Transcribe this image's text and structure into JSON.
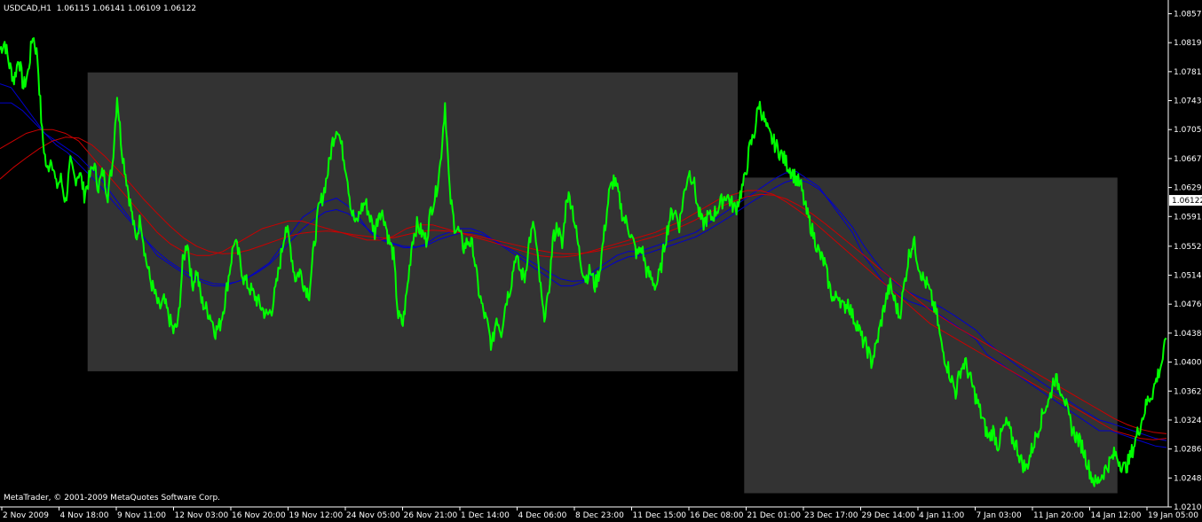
{
  "header": {
    "symbol": "USDCAD,H1",
    "ohlc": "1.06115 1.06141 1.06109 1.06122"
  },
  "footer": {
    "copyright": "MetaTrader, © 2001-2009 MetaQuotes Software Corp."
  },
  "colors": {
    "background": "#000000",
    "price_line": "#00ff00",
    "ma_blue": "#0000cc",
    "ma_red": "#cc0000",
    "box_fill": "#333333",
    "axis": "#ffffff"
  },
  "chart_data": {
    "type": "line",
    "symbol": "USDCAD",
    "timeframe": "H1",
    "current_price": 1.06122,
    "current_price_label": "1.06122",
    "ylim": [
      1.021,
      1.0875
    ],
    "y_ticks": [
      {
        "v": 1.0857,
        "l": "1.08570"
      },
      {
        "v": 1.0819,
        "l": "1.08190"
      },
      {
        "v": 1.0781,
        "l": "1.07810"
      },
      {
        "v": 1.0743,
        "l": "1.07430"
      },
      {
        "v": 1.0705,
        "l": "1.07050"
      },
      {
        "v": 1.0667,
        "l": "1.06670"
      },
      {
        "v": 1.0629,
        "l": "1.06290"
      },
      {
        "v": 1.0591,
        "l": "1.05910"
      },
      {
        "v": 1.0552,
        "l": "1.05520"
      },
      {
        "v": 1.0514,
        "l": "1.05140"
      },
      {
        "v": 1.0476,
        "l": "1.04760"
      },
      {
        "v": 1.0438,
        "l": "1.04380"
      },
      {
        "v": 1.04,
        "l": "1.04000"
      },
      {
        "v": 1.0362,
        "l": "1.03620"
      },
      {
        "v": 1.0324,
        "l": "1.03240"
      },
      {
        "v": 1.0286,
        "l": "1.02860"
      },
      {
        "v": 1.0248,
        "l": "1.02480"
      },
      {
        "v": 1.021,
        "l": "1.02100"
      }
    ],
    "x_ticks": [
      "2 Nov 2009",
      "4 Nov 18:00",
      "9 Nov 11:00",
      "12 Nov 03:00",
      "16 Nov 20:00",
      "19 Nov 12:00",
      "24 Nov 05:00",
      "26 Nov 21:00",
      "1 Dec 14:00",
      "4 Dec 06:00",
      "8 Dec 23:00",
      "11 Dec 15:00",
      "16 Dec 08:00",
      "21 Dec 01:00",
      "23 Dec 17:00",
      "29 Dec 14:00",
      "4 Jan 11:00",
      "7 Jan 03:00",
      "11 Jan 20:00",
      "14 Jan 12:00",
      "19 Jan 05:00"
    ],
    "series": [
      {
        "role": "price",
        "values": [
          1.081,
          1.082,
          1.079,
          1.077,
          1.08,
          1.076,
          1.078,
          1.083,
          1.08,
          1.07,
          1.065,
          1.067,
          1.063,
          1.064,
          1.061,
          1.066,
          1.064,
          1.065,
          1.062,
          1.064,
          1.066,
          1.063,
          1.065,
          1.062,
          1.066,
          1.075,
          1.068,
          1.064,
          1.06,
          1.056,
          1.059,
          1.054,
          1.051,
          1.049,
          1.047,
          1.048,
          1.046,
          1.044,
          1.045,
          1.053,
          1.056,
          1.05,
          1.052,
          1.048,
          1.047,
          1.046,
          1.044,
          1.045,
          1.048,
          1.052,
          1.056,
          1.054,
          1.051,
          1.05,
          1.049,
          1.048,
          1.047,
          1.046,
          1.047,
          1.05,
          1.054,
          1.058,
          1.055,
          1.051,
          1.052,
          1.05,
          1.049,
          1.055,
          1.06,
          1.062,
          1.065,
          1.069,
          1.071,
          1.068,
          1.065,
          1.06,
          1.058,
          1.06,
          1.061,
          1.059,
          1.057,
          1.06,
          1.059,
          1.056,
          1.054,
          1.046,
          1.045,
          1.05,
          1.056,
          1.058,
          1.057,
          1.056,
          1.06,
          1.062,
          1.066,
          1.074,
          1.062,
          1.058,
          1.057,
          1.055,
          1.056,
          1.055,
          1.05,
          1.047,
          1.045,
          1.042,
          1.046,
          1.044,
          1.048,
          1.05,
          1.054,
          1.052,
          1.051,
          1.056,
          1.058,
          1.052,
          1.046,
          1.048,
          1.056,
          1.058,
          1.055,
          1.062,
          1.061,
          1.057,
          1.053,
          1.051,
          1.052,
          1.05,
          1.052,
          1.057,
          1.062,
          1.064,
          1.062,
          1.059,
          1.058,
          1.056,
          1.054,
          1.055,
          1.052,
          1.051,
          1.05,
          1.052,
          1.056,
          1.059,
          1.06,
          1.058,
          1.062,
          1.065,
          1.064,
          1.06,
          1.058,
          1.059,
          1.059,
          1.06,
          1.061,
          1.062,
          1.061,
          1.06,
          1.062,
          1.064,
          1.068,
          1.07,
          1.074,
          1.072,
          1.07,
          1.069,
          1.068,
          1.067,
          1.066,
          1.065,
          1.064,
          1.063,
          1.06,
          1.058,
          1.056,
          1.054,
          1.053,
          1.05,
          1.048,
          1.049,
          1.047,
          1.048,
          1.046,
          1.045,
          1.043,
          1.042,
          1.04,
          1.042,
          1.045,
          1.048,
          1.05,
          1.048,
          1.046,
          1.05,
          1.054,
          1.056,
          1.053,
          1.051,
          1.05,
          1.048,
          1.046,
          1.042,
          1.04,
          1.038,
          1.036,
          1.039,
          1.04,
          1.038,
          1.036,
          1.034,
          1.032,
          1.03,
          1.031,
          1.029,
          1.031,
          1.032,
          1.03,
          1.029,
          1.027,
          1.026,
          1.028,
          1.03,
          1.032,
          1.034,
          1.035,
          1.038,
          1.037,
          1.036,
          1.033,
          1.031,
          1.03,
          1.029,
          1.027,
          1.025,
          1.024,
          1.025,
          1.026,
          1.027,
          1.028,
          1.027,
          1.026,
          1.027,
          1.029,
          1.031,
          1.033,
          1.035,
          1.036,
          1.038,
          1.04,
          1.043
        ]
      },
      {
        "role": "ma-blue-fast",
        "values": [
          1.0765,
          1.076,
          1.074,
          1.072,
          1.07,
          1.069,
          1.068,
          1.067,
          1.0655,
          1.064,
          1.062,
          1.06,
          1.058,
          1.056,
          1.054,
          1.053,
          1.052,
          1.051,
          1.0505,
          1.05,
          1.05,
          1.0505,
          1.051,
          1.052,
          1.053,
          1.055,
          1.057,
          1.059,
          1.06,
          1.061,
          1.0615,
          1.0605,
          1.059,
          1.057,
          1.056,
          1.0555,
          1.055,
          1.055,
          1.0555,
          1.0565,
          1.057,
          1.0575,
          1.0575,
          1.057,
          1.056,
          1.055,
          1.054,
          1.053,
          1.052,
          1.051,
          1.05,
          1.05,
          1.0505,
          1.052,
          1.053,
          1.054,
          1.0545,
          1.0545,
          1.055,
          1.0555,
          1.056,
          1.0565,
          1.057,
          1.058,
          1.059,
          1.06,
          1.061,
          1.062,
          1.063,
          1.064,
          1.0648,
          1.065,
          1.064,
          1.063,
          1.061,
          1.059,
          1.057,
          1.054,
          1.052,
          1.05,
          1.049,
          1.048,
          1.0475,
          1.047,
          1.046,
          1.045,
          1.044,
          1.043,
          1.041,
          1.04,
          1.039,
          1.038,
          1.037,
          1.036,
          1.035,
          1.034,
          1.033,
          1.032,
          1.031,
          1.031,
          1.0305,
          1.03,
          1.0295,
          1.029,
          1.0288
        ]
      },
      {
        "role": "ma-blue-slow",
        "values": [
          1.074,
          1.074,
          1.073,
          1.0715,
          1.07,
          1.0685,
          1.0675,
          1.066,
          1.0645,
          1.063,
          1.0612,
          1.0595,
          1.0578,
          1.056,
          1.0545,
          1.0533,
          1.0523,
          1.0515,
          1.0508,
          1.0503,
          1.0502,
          1.0505,
          1.051,
          1.0518,
          1.0528,
          1.0543,
          1.056,
          1.0575,
          1.0587,
          1.0597,
          1.06,
          1.0595,
          1.0585,
          1.0572,
          1.0562,
          1.0556,
          1.0552,
          1.0551,
          1.0553,
          1.056,
          1.0565,
          1.0569,
          1.057,
          1.0567,
          1.056,
          1.0552,
          1.0544,
          1.0535,
          1.0526,
          1.0517,
          1.0509,
          1.0506,
          1.0507,
          1.0515,
          1.0524,
          1.0532,
          1.0538,
          1.054,
          1.0544,
          1.0549,
          1.0554,
          1.0559,
          1.0564,
          1.0572,
          1.0581,
          1.059,
          1.06,
          1.061,
          1.0619,
          1.0628,
          1.0636,
          1.064,
          1.0636,
          1.0627,
          1.0612,
          1.0595,
          1.0577,
          1.0553,
          1.0533,
          1.0515,
          1.0502,
          1.0492,
          1.0485,
          1.0479,
          1.0471,
          1.0462,
          1.0452,
          1.0442,
          1.0426,
          1.0414,
          1.0403,
          1.0392,
          1.0382,
          1.0372,
          1.0362,
          1.0352,
          1.0342,
          1.0333,
          1.0324,
          1.032,
          1.0315,
          1.031,
          1.0305,
          1.03,
          1.0297
        ]
      },
      {
        "role": "ma-red-fast",
        "values": [
          1.068,
          1.069,
          1.07,
          1.0705,
          1.0705,
          1.07,
          1.069,
          1.067,
          1.065,
          1.063,
          1.061,
          1.059,
          1.057,
          1.0555,
          1.0545,
          1.054,
          1.054,
          1.0545,
          1.0555,
          1.0565,
          1.0575,
          1.058,
          1.0585,
          1.0585,
          1.058,
          1.0575,
          1.057,
          1.0565,
          1.056,
          1.056,
          1.0565,
          1.0575,
          1.058,
          1.058,
          1.0575,
          1.057,
          1.0565,
          1.056,
          1.0555,
          1.055,
          1.0545,
          1.054,
          1.0538,
          1.0538,
          1.054,
          1.0545,
          1.055,
          1.0555,
          1.056,
          1.0565,
          1.057,
          1.0578,
          1.0585,
          1.0595,
          1.0605,
          1.0615,
          1.062,
          1.0625,
          1.0625,
          1.062,
          1.061,
          1.0598,
          1.0585,
          1.057,
          1.0555,
          1.054,
          1.0525,
          1.051,
          1.0495,
          1.048,
          1.0465,
          1.045,
          1.044,
          1.043,
          1.042,
          1.041,
          1.04,
          1.039,
          1.038,
          1.037,
          1.036,
          1.035,
          1.034,
          1.033,
          1.032,
          1.031,
          1.0305,
          1.03,
          1.0298,
          1.03
        ]
      },
      {
        "role": "ma-red-slow",
        "values": [
          1.064,
          1.0655,
          1.0668,
          1.068,
          1.069,
          1.0695,
          1.0694,
          1.0685,
          1.067,
          1.0652,
          1.0633,
          1.0613,
          1.0595,
          1.0578,
          1.0563,
          1.0552,
          1.0545,
          1.0542,
          1.0543,
          1.0547,
          1.0553,
          1.0559,
          1.0565,
          1.0569,
          1.0571,
          1.0572,
          1.057,
          1.0567,
          1.0565,
          1.0563,
          1.0563,
          1.0567,
          1.0571,
          1.0573,
          1.0572,
          1.057,
          1.0567,
          1.0563,
          1.0559,
          1.0555,
          1.0551,
          1.0547,
          1.0544,
          1.0542,
          1.0542,
          1.0544,
          1.0547,
          1.0551,
          1.0555,
          1.056,
          1.0565,
          1.0571,
          1.0578,
          1.0586,
          1.0595,
          1.0604,
          1.0611,
          1.0617,
          1.062,
          1.0619,
          1.0614,
          1.0605,
          1.0594,
          1.0581,
          1.0567,
          1.0553,
          1.0539,
          1.0524,
          1.051,
          1.0496,
          1.0482,
          1.0468,
          1.0457,
          1.0446,
          1.0436,
          1.0426,
          1.0416,
          1.0406,
          1.0396,
          1.0386,
          1.0376,
          1.0366,
          1.0356,
          1.0346,
          1.0336,
          1.0326,
          1.0318,
          1.0312,
          1.0308,
          1.0306
        ]
      }
    ],
    "highlight_boxes": [
      {
        "x_from": 0.075,
        "x_to": 0.6315,
        "y_from": 1.078,
        "y_to": 1.0388
      },
      {
        "x_from": 0.637,
        "x_to": 0.9565,
        "y_from": 1.0642,
        "y_to": 1.0228
      }
    ]
  }
}
